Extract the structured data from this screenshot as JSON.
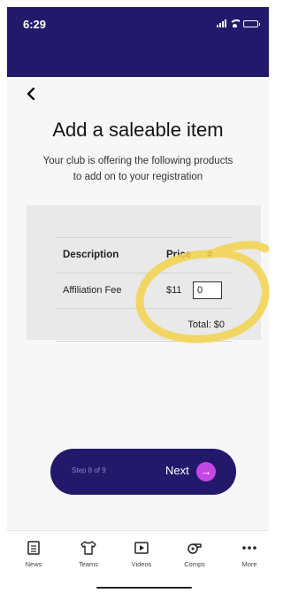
{
  "status_bar": {
    "time": "6:29"
  },
  "nav": {
    "back_icon": "chevron-left-icon"
  },
  "page": {
    "title": "Add a saleable item",
    "subtitle": "Your club is offering the following products to add on to your registration"
  },
  "table": {
    "headers": {
      "description": "Description",
      "price": "Price",
      "qty": "#"
    },
    "rows": [
      {
        "description": "Affiliation Fee",
        "price": "$11",
        "qty": "0"
      }
    ],
    "total": "Total: $0"
  },
  "footer": {
    "step": "Step 8 of 9",
    "next_label": "Next",
    "next_icon": "arrow-right-icon"
  },
  "tabs": [
    {
      "label": "News",
      "icon": "news-icon"
    },
    {
      "label": "Teams",
      "icon": "shirt-icon"
    },
    {
      "label": "Videos",
      "icon": "video-icon"
    },
    {
      "label": "Comps",
      "icon": "whistle-icon"
    },
    {
      "label": "More",
      "icon": "more-icon"
    }
  ],
  "colors": {
    "header": "#23196b",
    "accent": "#c547e5",
    "annotation": "#f2d24b"
  }
}
